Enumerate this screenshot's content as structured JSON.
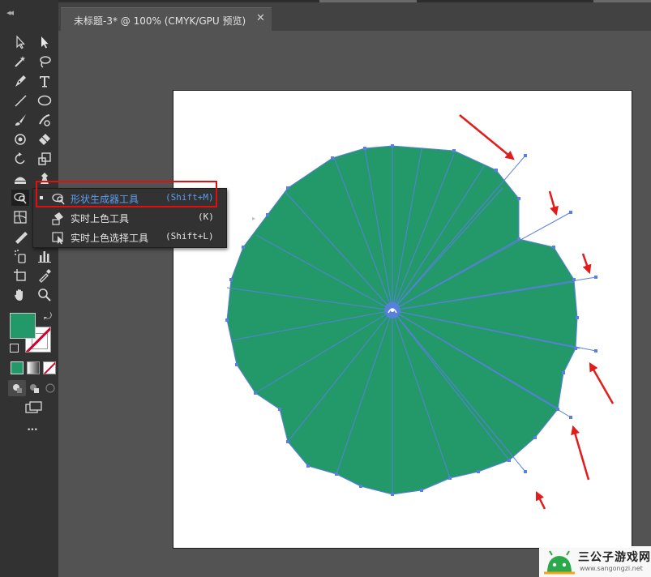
{
  "document_tab": {
    "title": "未标题-3* @ 100% (CMYK/GPU 预览)",
    "close_glyph": "✕"
  },
  "toolbar": {
    "collapse_glyph": "◂◂",
    "more_glyph": "•••",
    "fill_color": "#23996a",
    "tools": [
      "selection-tool",
      "direct-selection-tool",
      "magic-wand-tool",
      "lasso-tool",
      "pen-tool",
      "type-tool",
      "line-segment-tool",
      "ellipse-tool",
      "paintbrush-tool",
      "shaper-tool",
      "blob-brush-tool",
      "eraser-tool",
      "rotate-tool",
      "scale-tool",
      "width-tool",
      "free-transform-tool",
      "shape-builder-tool",
      "perspective-grid-tool",
      "mesh-tool",
      "gradient-tool",
      "symbol-sprayer-tool",
      "column-graph-tool",
      "artboard-tool",
      "eyedropper-tool",
      "hand-tool",
      "zoom-tool"
    ]
  },
  "flyout": {
    "items": [
      {
        "label": "形状生成器工具",
        "shortcut": "(Shift+M)",
        "active": true
      },
      {
        "label": "实时上色工具",
        "shortcut": "(K)",
        "active": false
      },
      {
        "label": "实时上色选择工具",
        "shortcut": "(Shift+L)",
        "active": false
      }
    ]
  },
  "artwork": {
    "shape_fill": "#23996a",
    "path_color": "#5a7fe0",
    "annotation_color": "#e31b1b"
  },
  "watermark": {
    "title": "三公子游戏网",
    "url": "www.sangongzi.net"
  }
}
